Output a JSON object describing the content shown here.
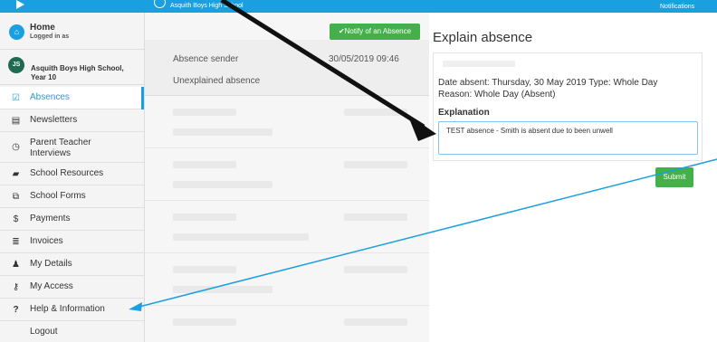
{
  "topbar": {
    "school": "Asquith Boys High School",
    "notifications": "Notifications"
  },
  "sidebar": {
    "home_title": "Home",
    "home_sub": "Logged in as",
    "profile_initials": "JS",
    "profile_name": "Asquith Boys High School, Year 10",
    "items": [
      {
        "label": "Absences",
        "icon": "checkbox-icon",
        "glyph": "☑"
      },
      {
        "label": "Newsletters",
        "icon": "newspaper-icon",
        "glyph": "▤"
      },
      {
        "label": "Parent Teacher Interviews",
        "icon": "clock-icon",
        "glyph": "◷"
      },
      {
        "label": "School Resources",
        "icon": "folder-icon",
        "glyph": "▰"
      },
      {
        "label": "School Forms",
        "icon": "copy-icon",
        "glyph": "⧉"
      },
      {
        "label": "Payments",
        "icon": "dollar-icon",
        "glyph": "$"
      },
      {
        "label": "Invoices",
        "icon": "list-icon",
        "glyph": "≣"
      },
      {
        "label": "My Details",
        "icon": "user-icon",
        "glyph": "♟"
      },
      {
        "label": "My Access",
        "icon": "key-icon",
        "glyph": "⚷"
      },
      {
        "label": "Help & Information",
        "icon": "help-icon",
        "glyph": "?"
      },
      {
        "label": "Logout",
        "icon": "",
        "glyph": ""
      }
    ]
  },
  "list": {
    "notify_button": "✔Notify of an Absence",
    "sender_label": "Absence sender",
    "sender_date": "30/05/2019 09:46",
    "status": "Unexplained absence"
  },
  "detail": {
    "title": "Explain absence",
    "date_line": "Date absent: Thursday, 30 May 2019 Type: Whole Day",
    "reason_line": "Reason: Whole Day (Absent)",
    "explanation_heading": "Explanation",
    "explanation_value": "TEST absence - Smith is absent due to been unwell",
    "submit_label": "Submit"
  },
  "colors": {
    "brand": "#1a9fe0",
    "success": "#45b049",
    "annotation_arrow": "#111111",
    "annotation_line": "#1a9fe0"
  }
}
